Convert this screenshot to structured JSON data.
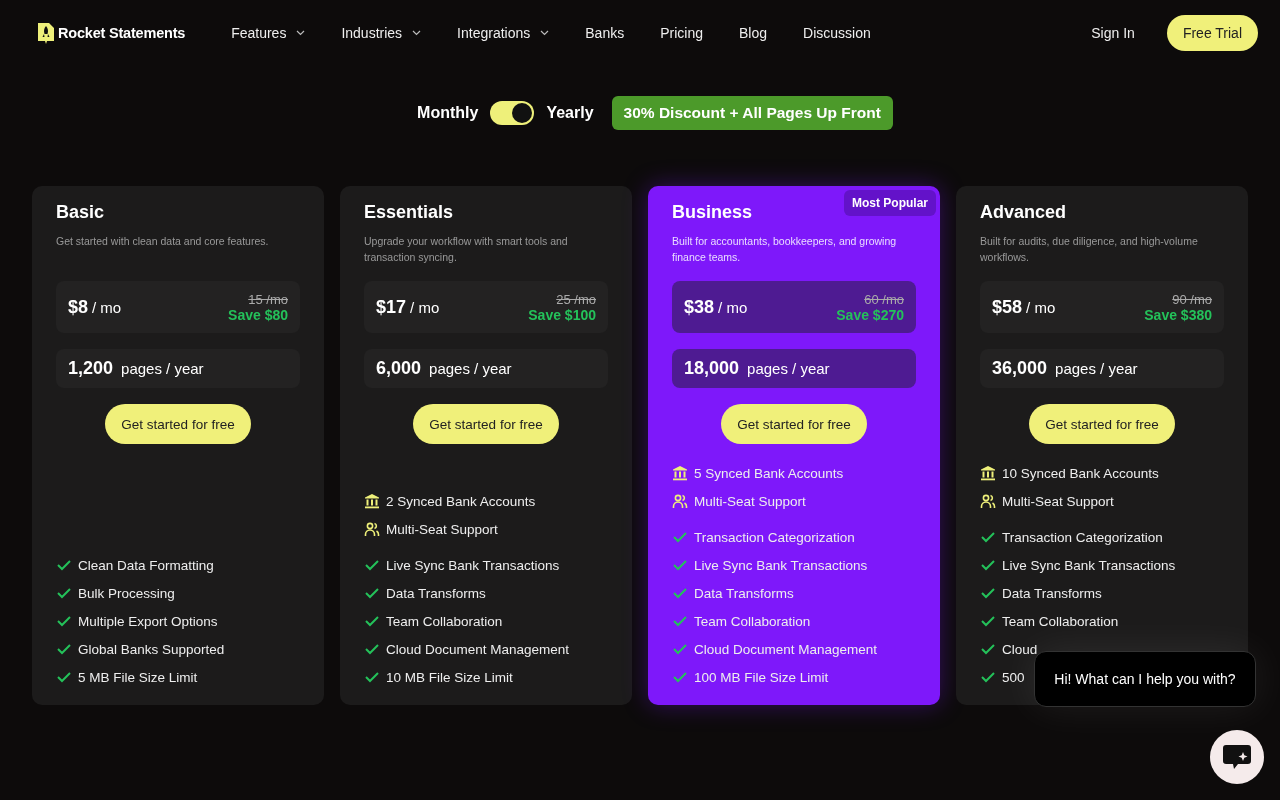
{
  "nav": {
    "brand": "Rocket Statements",
    "links": [
      {
        "label": "Features",
        "dropdown": true
      },
      {
        "label": "Industries",
        "dropdown": true
      },
      {
        "label": "Integrations",
        "dropdown": true
      },
      {
        "label": "Banks",
        "dropdown": false
      },
      {
        "label": "Pricing",
        "dropdown": false
      },
      {
        "label": "Blog",
        "dropdown": false
      },
      {
        "label": "Discussion",
        "dropdown": false
      }
    ],
    "sign_in": "Sign In",
    "cta": "Free Trial"
  },
  "billing": {
    "monthly_label": "Monthly",
    "yearly_label": "Yearly",
    "yearly": true,
    "discount": "30% Discount + All Pages Up Front"
  },
  "plans": [
    {
      "name": "Basic",
      "description": "Get started with clean data and core features.",
      "price": "$8",
      "unit": "/ mo",
      "old_price": "15 /mo",
      "save": "Save $80",
      "pages": "1,200",
      "pages_unit": "pages / year",
      "button": "Get started for free",
      "highlighted": false,
      "features": [
        "Clean Data Formatting",
        "Bulk Processing",
        "Multiple Export Options",
        "Global Banks Supported",
        "5 MB File Size Limit"
      ]
    },
    {
      "name": "Essentials",
      "description": "Upgrade your workflow with smart tools and transaction syncing.",
      "price": "$17",
      "unit": "/ mo",
      "old_price": "25 /mo",
      "save": "Save $100",
      "pages": "6,000",
      "pages_unit": "pages / year",
      "button": "Get started for free",
      "highlighted": false,
      "extras": [
        {
          "kind": "bank",
          "text": "2 Synced Bank Accounts"
        },
        {
          "kind": "seats",
          "text": "Multi-Seat Support"
        }
      ],
      "features": [
        "Live Sync Bank Transactions",
        "Data Transforms",
        "Team Collaboration",
        "Cloud Document Management",
        "10 MB File Size Limit"
      ]
    },
    {
      "name": "Business",
      "badge": "Most Popular",
      "description": "Built for accountants, bookkeepers, and growing finance teams.",
      "price": "$38",
      "unit": "/ mo",
      "old_price": "60 /mo",
      "save": "Save $270",
      "pages": "18,000",
      "pages_unit": "pages / year",
      "button": "Get started for free",
      "highlighted": true,
      "extras": [
        {
          "kind": "bank",
          "text": "5 Synced Bank Accounts"
        },
        {
          "kind": "seats",
          "text": "Multi-Seat Support"
        }
      ],
      "features": [
        "Transaction Categorization",
        "Live Sync Bank Transactions",
        "Data Transforms",
        "Team Collaboration",
        "Cloud Document Management",
        "100 MB File Size Limit"
      ]
    },
    {
      "name": "Advanced",
      "description": "Built for audits, due diligence, and high-volume workflows.",
      "price": "$58",
      "unit": "/ mo",
      "old_price": "90 /mo",
      "save": "Save $380",
      "pages": "36,000",
      "pages_unit": "pages / year",
      "button": "Get started for free",
      "highlighted": false,
      "extras": [
        {
          "kind": "bank",
          "text": "10 Synced Bank Accounts"
        },
        {
          "kind": "seats",
          "text": "Multi-Seat Support"
        }
      ],
      "features": [
        "Transaction Categorization",
        "Live Sync Bank Transactions",
        "Data Transforms",
        "Team Collaboration",
        "Cloud",
        "500"
      ]
    }
  ],
  "chat": {
    "message": "Hi! What can I help you with?"
  }
}
